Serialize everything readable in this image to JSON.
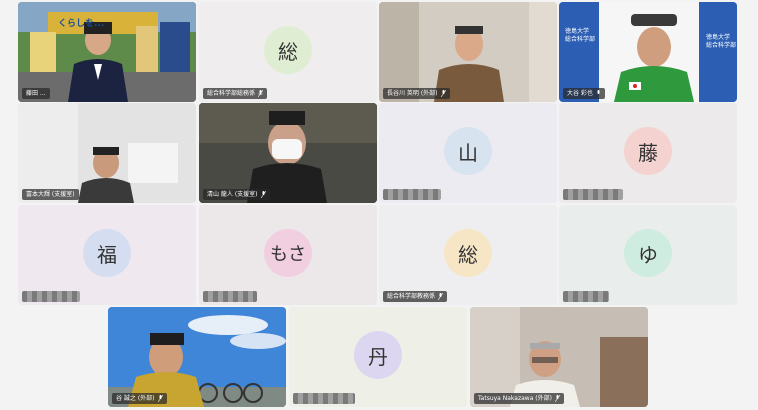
{
  "tiles": {
    "t1": {
      "name": "藤田 ...",
      "caption": "くらしを..."
    },
    "t2": {
      "avatar": "総",
      "name": "総合科学部総務係"
    },
    "t3": {
      "name": "長谷川 英明 (外部)"
    },
    "t4": {
      "name": "大谷 彩也",
      "logo_line1": "徳島大学",
      "logo_line2": "総合科学部"
    },
    "t5": {
      "name": "富本大輝 (支援室)"
    },
    "t6": {
      "name": "清山 龍人 (支援室)"
    },
    "t7": {
      "avatar": "山"
    },
    "t8": {
      "avatar": "藤"
    },
    "t9": {
      "avatar": "福"
    },
    "t10": {
      "avatar": "もさ"
    },
    "t11": {
      "avatar": "総",
      "name": "総合科学部教務係"
    },
    "t12": {
      "avatar": "ゆ"
    },
    "t13": {
      "name": "谷 誠之 (外部)"
    },
    "t14": {
      "avatar": "丹"
    },
    "t15": {
      "name": "Tatsuya Nakazawa (外部)"
    }
  },
  "colors": {
    "active_outline": "#5b7de6",
    "avatar_green": "#dfeed3",
    "avatar_blue": "#d7e3ef",
    "avatar_pink": "#f3d2cf",
    "avatar_lavender": "#d5ddf0",
    "avatar_rose": "#f2cfe0",
    "avatar_peach": "#f6e6c6",
    "avatar_mint": "#cfece0",
    "avatar_purple": "#dcd6f0"
  },
  "icons": {
    "mic": "microphone-icon",
    "muted": "mic-off-icon"
  }
}
